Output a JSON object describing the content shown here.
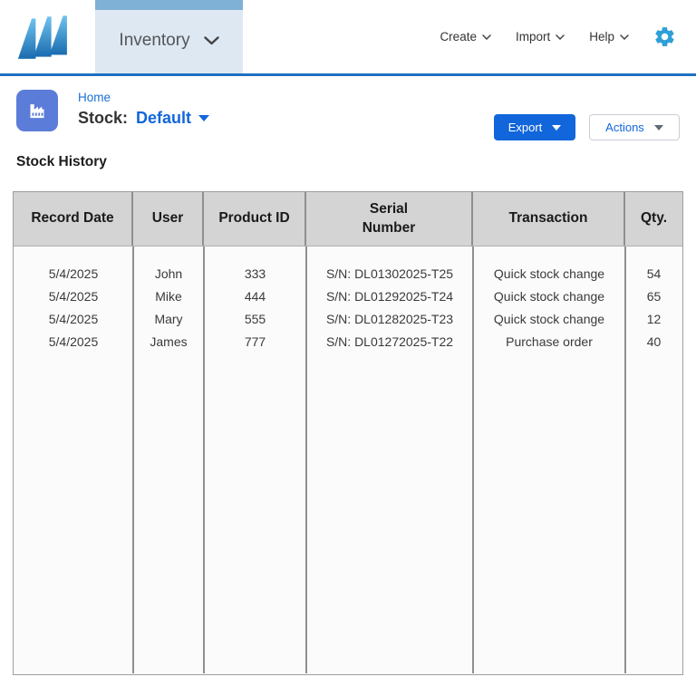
{
  "nav": {
    "tab": {
      "label": "Inventory"
    },
    "menus": [
      {
        "label": "Create"
      },
      {
        "label": "Import"
      },
      {
        "label": "Help"
      }
    ]
  },
  "breadcrumb": {
    "home": "Home",
    "stock_label": "Stock:",
    "stock_value": "Default"
  },
  "toolbar": {
    "export_label": "Export",
    "actions_label": "Actions"
  },
  "page": {
    "section_title": "Stock History"
  },
  "table": {
    "headers": [
      "Record Date",
      "User",
      "Product ID",
      "Serial Number",
      "Transaction",
      "Qty."
    ],
    "rows": [
      {
        "record_date": "5/4/2025",
        "user": "John",
        "product_id": "333",
        "serial_number": "S/N: DL01302025-T25",
        "transaction": "Quick stock change",
        "qty": "54"
      },
      {
        "record_date": "5/4/2025",
        "user": "Mike",
        "product_id": "444",
        "serial_number": "S/N: DL01292025-T24",
        "transaction": "Quick stock change",
        "qty": "65"
      },
      {
        "record_date": "5/4/2025",
        "user": "Mary",
        "product_id": "555",
        "serial_number": "S/N: DL01282025-T23",
        "transaction": "Quick stock change",
        "qty": "12"
      },
      {
        "record_date": "5/4/2025",
        "user": "James",
        "product_id": "777",
        "serial_number": "S/N: DL01272025-T22",
        "transaction": "Purchase order",
        "qty": "40"
      }
    ]
  },
  "icons": {
    "logo": "brand-sails-logo",
    "gear": "settings-gear-icon",
    "factory": "factory-icon",
    "chevron": "chevron-down-icon"
  },
  "colors": {
    "accent_blue": "#1266db",
    "link_blue": "#1a6fd4",
    "gear_blue": "#2e9fd8",
    "tab_background": "#dde8f3",
    "tab_strip": "#7fb0d6",
    "nav_divider": "#1e70c1",
    "table_header_bg": "#d4d4d4",
    "table_border": "#9e9e9e",
    "app_icon_bg": "#5b7cd9"
  }
}
